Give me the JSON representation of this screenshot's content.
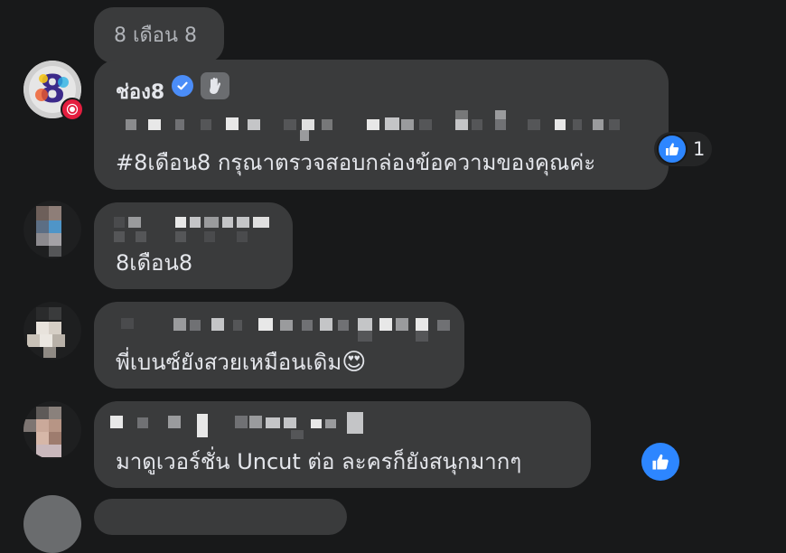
{
  "comments": [
    {
      "author": "8 เดือน 8",
      "text": ""
    },
    {
      "author": "ช่อง8",
      "verified": true,
      "text": "#8เดือน8 กรุณาตรวจสอบกล่องข้อความของคุณค่ะ",
      "reaction_count": "1",
      "colors": {
        "verified": "#4b8df8",
        "like": "#2d86ff"
      }
    },
    {
      "author": "",
      "text": "8เดือน8"
    },
    {
      "author": "",
      "text": "พี่เบนซ์ยังสวยเหมือนเดิม",
      "emoji": "😍"
    },
    {
      "author": "",
      "text": "มาดูเวอร์ชั่น Uncut ต่อ ละครก็ยังสนุกมากๆ",
      "reaction": "like-icon"
    }
  ],
  "icons": [
    "verified-badge-icon",
    "wave-hand-icon",
    "like-icon",
    "avatar-page-icon"
  ]
}
